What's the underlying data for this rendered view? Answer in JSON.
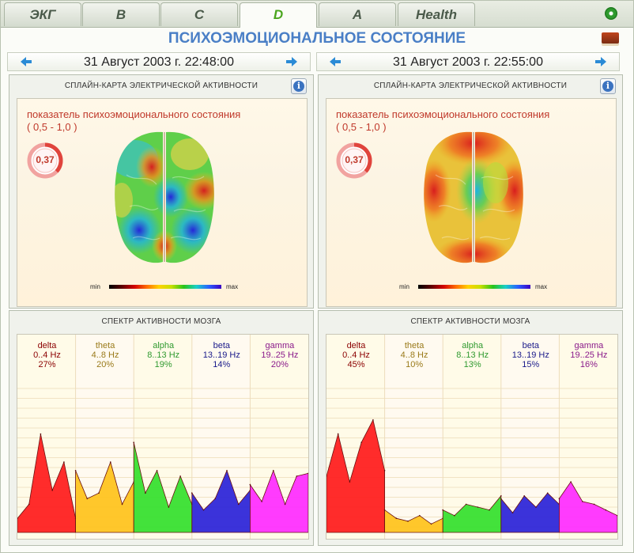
{
  "tabs": [
    {
      "label": "ЭКГ",
      "active": false
    },
    {
      "label": "B",
      "active": false
    },
    {
      "label": "C",
      "active": false
    },
    {
      "label": "D",
      "active": true
    },
    {
      "label": "A",
      "active": false
    },
    {
      "label": "Health",
      "active": false
    }
  ],
  "page_title": "ПСИХОЭМОЦИОНАЛЬНОЕ СОСТОЯНИЕ",
  "sessions": [
    {
      "date": "31 Август 2003 г. 22:48:00",
      "map_panel_title": "СПЛАЙН-КАРТА ЭЛЕКТРИЧЕСКОЙ АКТИВНОСТИ",
      "indicator_label": "показатель психоэмоционального состояния",
      "indicator_range": "( 0,5 - 1,0 )",
      "indicator_value": "0,37",
      "indicator_fraction": 0.37,
      "scale_min": "min",
      "scale_max": "max",
      "spectrum_title": "СПЕКТР АКТИВНОСТИ МОЗГА",
      "bands": [
        {
          "name": "delta",
          "range": "0..4 Hz",
          "percent": "27%",
          "color": "#8b0000"
        },
        {
          "name": "theta",
          "range": "4..8 Hz",
          "percent": "20%",
          "color": "#9a7a1a"
        },
        {
          "name": "alpha",
          "range": "8..13 Hz",
          "percent": "19%",
          "color": "#2f9a2f"
        },
        {
          "name": "beta",
          "range": "13..19 Hz",
          "percent": "14%",
          "color": "#1a1a8a"
        },
        {
          "name": "gamma",
          "range": "19..25 Hz",
          "percent": "20%",
          "color": "#8a1a8a"
        }
      ],
      "spectrum": [
        [
          0.05,
          0.1,
          0.35,
          0.15,
          0.25,
          0.05
        ],
        [
          0.22,
          0.12,
          0.14,
          0.25,
          0.1,
          0.18
        ],
        [
          0.32,
          0.14,
          0.22,
          0.09,
          0.2,
          0.1
        ],
        [
          0.14,
          0.08,
          0.12,
          0.22,
          0.1,
          0.15
        ],
        [
          0.17,
          0.11,
          0.22,
          0.1,
          0.2,
          0.21
        ]
      ],
      "spectrum_peak": 0.45
    },
    {
      "date": "31 Август 2003 г. 22:55:00",
      "map_panel_title": "СПЛАЙН-КАРТА ЭЛЕКТРИЧЕСКОЙ АКТИВНОСТИ",
      "indicator_label": "показатель психоэмоционального состояния",
      "indicator_range": "( 0,5 - 1,0 )",
      "indicator_value": "0,37",
      "indicator_fraction": 0.37,
      "scale_min": "min",
      "scale_max": "max",
      "spectrum_title": "СПЕКТР АКТИВНОСТИ МОЗГА",
      "bands": [
        {
          "name": "delta",
          "range": "0..4 Hz",
          "percent": "45%",
          "color": "#8b0000"
        },
        {
          "name": "theta",
          "range": "4..8 Hz",
          "percent": "10%",
          "color": "#9a7a1a"
        },
        {
          "name": "alpha",
          "range": "8..13 Hz",
          "percent": "13%",
          "color": "#2f9a2f"
        },
        {
          "name": "beta",
          "range": "13..19 Hz",
          "percent": "15%",
          "color": "#1a1a8a"
        },
        {
          "name": "gamma",
          "range": "19..25 Hz",
          "percent": "16%",
          "color": "#8a1a8a"
        }
      ],
      "spectrum": [
        [
          0.2,
          0.35,
          0.18,
          0.32,
          0.4,
          0.22
        ],
        [
          0.08,
          0.05,
          0.04,
          0.06,
          0.03,
          0.05
        ],
        [
          0.08,
          0.06,
          0.1,
          0.09,
          0.08,
          0.13
        ],
        [
          0.12,
          0.07,
          0.13,
          0.09,
          0.14,
          0.1
        ],
        [
          0.12,
          0.18,
          0.11,
          0.1,
          0.08,
          0.06
        ]
      ],
      "spectrum_peak": 0.45
    }
  ]
}
